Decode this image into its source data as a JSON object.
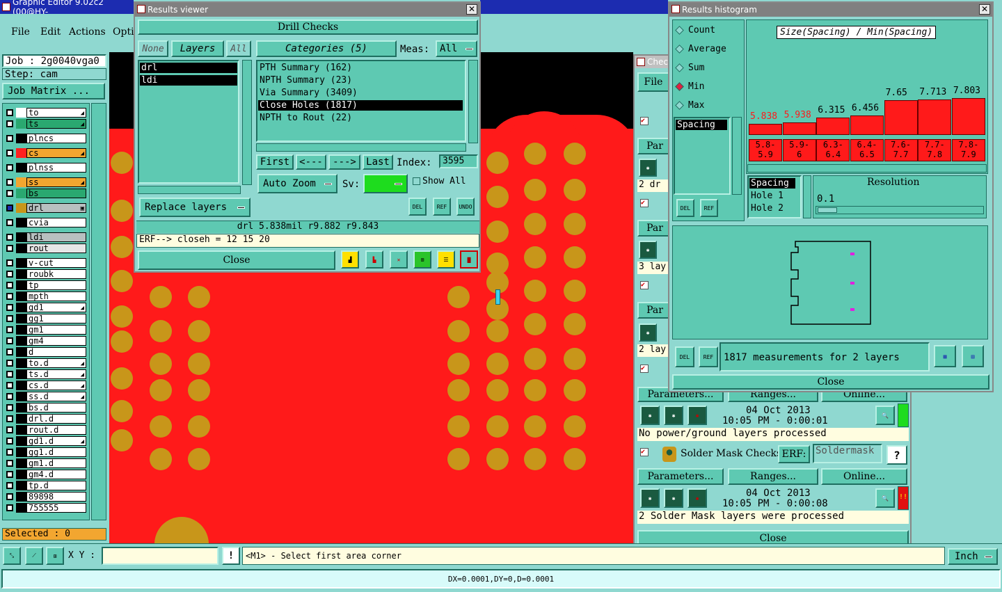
{
  "main_title": "Graphic Editor 9.02c2 (00@HY-",
  "menu": [
    "File",
    "Edit",
    "Actions",
    "Opti"
  ],
  "job": "Job : 2g0040vga0",
  "step": "Step: cam",
  "job_matrix": "Job Matrix ...",
  "layers": [
    {
      "name": "to",
      "color": "#ffffff",
      "swatch": "#ffffff",
      "mark": "◢"
    },
    {
      "name": "ts",
      "color": "#2aa870",
      "swatch": "#2aa870",
      "mark": "◢"
    },
    {
      "name": "plncs",
      "color": "#ffffff",
      "swatch": "#000000",
      "mark": ""
    },
    {
      "name": "cs",
      "color": "#f2a630",
      "swatch": "#ff2020",
      "mark": "◢"
    },
    {
      "name": "plnss",
      "color": "#ffffff",
      "swatch": "#000000",
      "mark": ""
    },
    {
      "name": "ss",
      "color": "#f2a630",
      "swatch": "#f2a630",
      "mark": "◢"
    },
    {
      "name": "bs",
      "color": "#2aa870",
      "swatch": "#2aa870",
      "mark": ""
    },
    {
      "name": "drl",
      "color": "#b8c0c0",
      "swatch": "#c8961a",
      "mark": "▣"
    },
    {
      "name": "cvia",
      "color": "#ffffff",
      "swatch": "#000000",
      "mark": ""
    },
    {
      "name": "ldi",
      "color": "#b8c0c0",
      "swatch": "#000000",
      "mark": ""
    },
    {
      "name": "rout",
      "color": "#e6e6e6",
      "swatch": "#000000",
      "mark": ""
    },
    {
      "name": "v-cut",
      "color": "#ffffff",
      "swatch": "#000000",
      "mark": ""
    },
    {
      "name": "roubk",
      "color": "#ffffff",
      "swatch": "#000000",
      "mark": ""
    },
    {
      "name": "tp",
      "color": "#ffffff",
      "swatch": "#000000",
      "mark": ""
    },
    {
      "name": "mpth",
      "color": "#ffffff",
      "swatch": "#000000",
      "mark": ""
    },
    {
      "name": "gd1",
      "color": "#ffffff",
      "swatch": "#000000",
      "mark": "◢"
    },
    {
      "name": "gg1",
      "color": "#ffffff",
      "swatch": "#000000",
      "mark": ""
    },
    {
      "name": "gm1",
      "color": "#ffffff",
      "swatch": "#000000",
      "mark": ""
    },
    {
      "name": "gm4",
      "color": "#ffffff",
      "swatch": "#000000",
      "mark": ""
    },
    {
      "name": "d",
      "color": "#ffffff",
      "swatch": "#000000",
      "mark": ""
    },
    {
      "name": "to.d",
      "color": "#ffffff",
      "swatch": "#000000",
      "mark": "◢"
    },
    {
      "name": "ts.d",
      "color": "#ffffff",
      "swatch": "#000000",
      "mark": "◢"
    },
    {
      "name": "cs.d",
      "color": "#ffffff",
      "swatch": "#000000",
      "mark": "◢"
    },
    {
      "name": "ss.d",
      "color": "#ffffff",
      "swatch": "#000000",
      "mark": "◢"
    },
    {
      "name": "bs.d",
      "color": "#ffffff",
      "swatch": "#000000",
      "mark": ""
    },
    {
      "name": "drl.d",
      "color": "#ffffff",
      "swatch": "#000000",
      "mark": ""
    },
    {
      "name": "rout.d",
      "color": "#ffffff",
      "swatch": "#000000",
      "mark": ""
    },
    {
      "name": "gd1.d",
      "color": "#ffffff",
      "swatch": "#000000",
      "mark": "◢"
    },
    {
      "name": "gg1.d",
      "color": "#ffffff",
      "swatch": "#000000",
      "mark": ""
    },
    {
      "name": "gm1.d",
      "color": "#ffffff",
      "swatch": "#000000",
      "mark": ""
    },
    {
      "name": "gm4.d",
      "color": "#ffffff",
      "swatch": "#000000",
      "mark": ""
    },
    {
      "name": "tp.d",
      "color": "#ffffff",
      "swatch": "#000000",
      "mark": ""
    },
    {
      "name": "89898",
      "color": "#ffffff",
      "swatch": "#000000",
      "mark": ""
    },
    {
      "name": "755555",
      "color": "#ffffff",
      "swatch": "#000000",
      "mark": ""
    }
  ],
  "selected": "Selected : 0",
  "xy_label": "X Y :",
  "prompt": "<M1> - Select first area corner",
  "units": "Inch",
  "status": "DX=0.0001,DY=0,D=0.0001",
  "rv": {
    "title": "Results viewer",
    "header": "Drill Checks",
    "none": "None",
    "layers": "Layers",
    "all": "All",
    "categories": "Categories (5)",
    "meas_label": "Meas:",
    "meas_value": "All",
    "layer_list": [
      "drl",
      "ldi"
    ],
    "cat_list": [
      "PTH Summary (162)",
      "NPTH Summary (23)",
      "Via Summary (3409)",
      "Close Holes (1817)",
      "NPTH to Rout (22)"
    ],
    "first": "First",
    "prev": "<---",
    "next": "--->",
    "last": "Last",
    "index_label": "Index:",
    "index_value": "3595",
    "auto_zoom": "Auto Zoom",
    "sv": "Sv:",
    "show_all": "Show All",
    "replace_layers": "Replace layers",
    "del": "DEL",
    "ref": "REF",
    "undo": "UNDO",
    "info": "drl 5.838mil  r9.882  r9.843",
    "erf": "ERF--> closeh = 12 15 20",
    "close": "Close"
  },
  "hist": {
    "title": "Results histogram",
    "radios": [
      "Count",
      "Average",
      "Sum",
      "Min",
      "Max"
    ],
    "selected_radio": "Min",
    "list": [
      "Spacing"
    ],
    "chart_title": "Size(Spacing) / Min(Spacing)",
    "del": "DEL",
    "ref": "REF",
    "spacing_list": [
      "Spacing",
      "Hole 1",
      "Hole 2"
    ],
    "resolution_label": "Resolution",
    "resolution_value": "0.1",
    "measurements": "1817 measurements for 2 layers",
    "close": "Close"
  },
  "chart_data": {
    "type": "bar",
    "title": "Size(Spacing) / Min(Spacing)",
    "categories": [
      "5.8-5.9",
      "5.9-6",
      "6.3-6.4",
      "6.4-6.5",
      "7.6-7.7",
      "7.7-7.8",
      "7.8-7.9"
    ],
    "values": [
      5.838,
      5.938,
      6.315,
      6.456,
      7.65,
      7.713,
      7.803
    ],
    "labels": [
      "5.838",
      "5.938",
      "6.315",
      "6.456",
      "7.65",
      "7.713",
      "7.803"
    ],
    "label_colors": [
      "#ff1a1a",
      "#ff1a1a",
      "#000000",
      "#000000",
      "#000000",
      "#000000",
      "#000000"
    ],
    "cat_labels_top": [
      "5.8-",
      "5.9-",
      "6.3-",
      "6.4-",
      "7.6-",
      "7.7-",
      "7.8-"
    ],
    "cat_labels_bot": [
      "5.9",
      "6",
      "6.4",
      "6.5",
      "7.7",
      "7.8",
      "7.9"
    ]
  },
  "checks": {
    "title": "Chec",
    "file": "File",
    "par": "Par",
    "rows_partial": [
      "2 dr",
      "3 lay",
      "2 lay"
    ],
    "buttons": [
      "Parameters...",
      "Ranges...",
      "Online..."
    ],
    "date": "04 Oct 2013",
    "time1": "10:05 PM - 0:00:01",
    "msg1": "No power/ground layers processed",
    "soldermask_title": "Solder Mask Checks",
    "erf": "ERF:",
    "erf_value": "Soldermask",
    "q": "?",
    "time2": "10:05 PM - 0:00:08",
    "msg2": "2 Solder Mask layers were processed",
    "close": "Close"
  }
}
